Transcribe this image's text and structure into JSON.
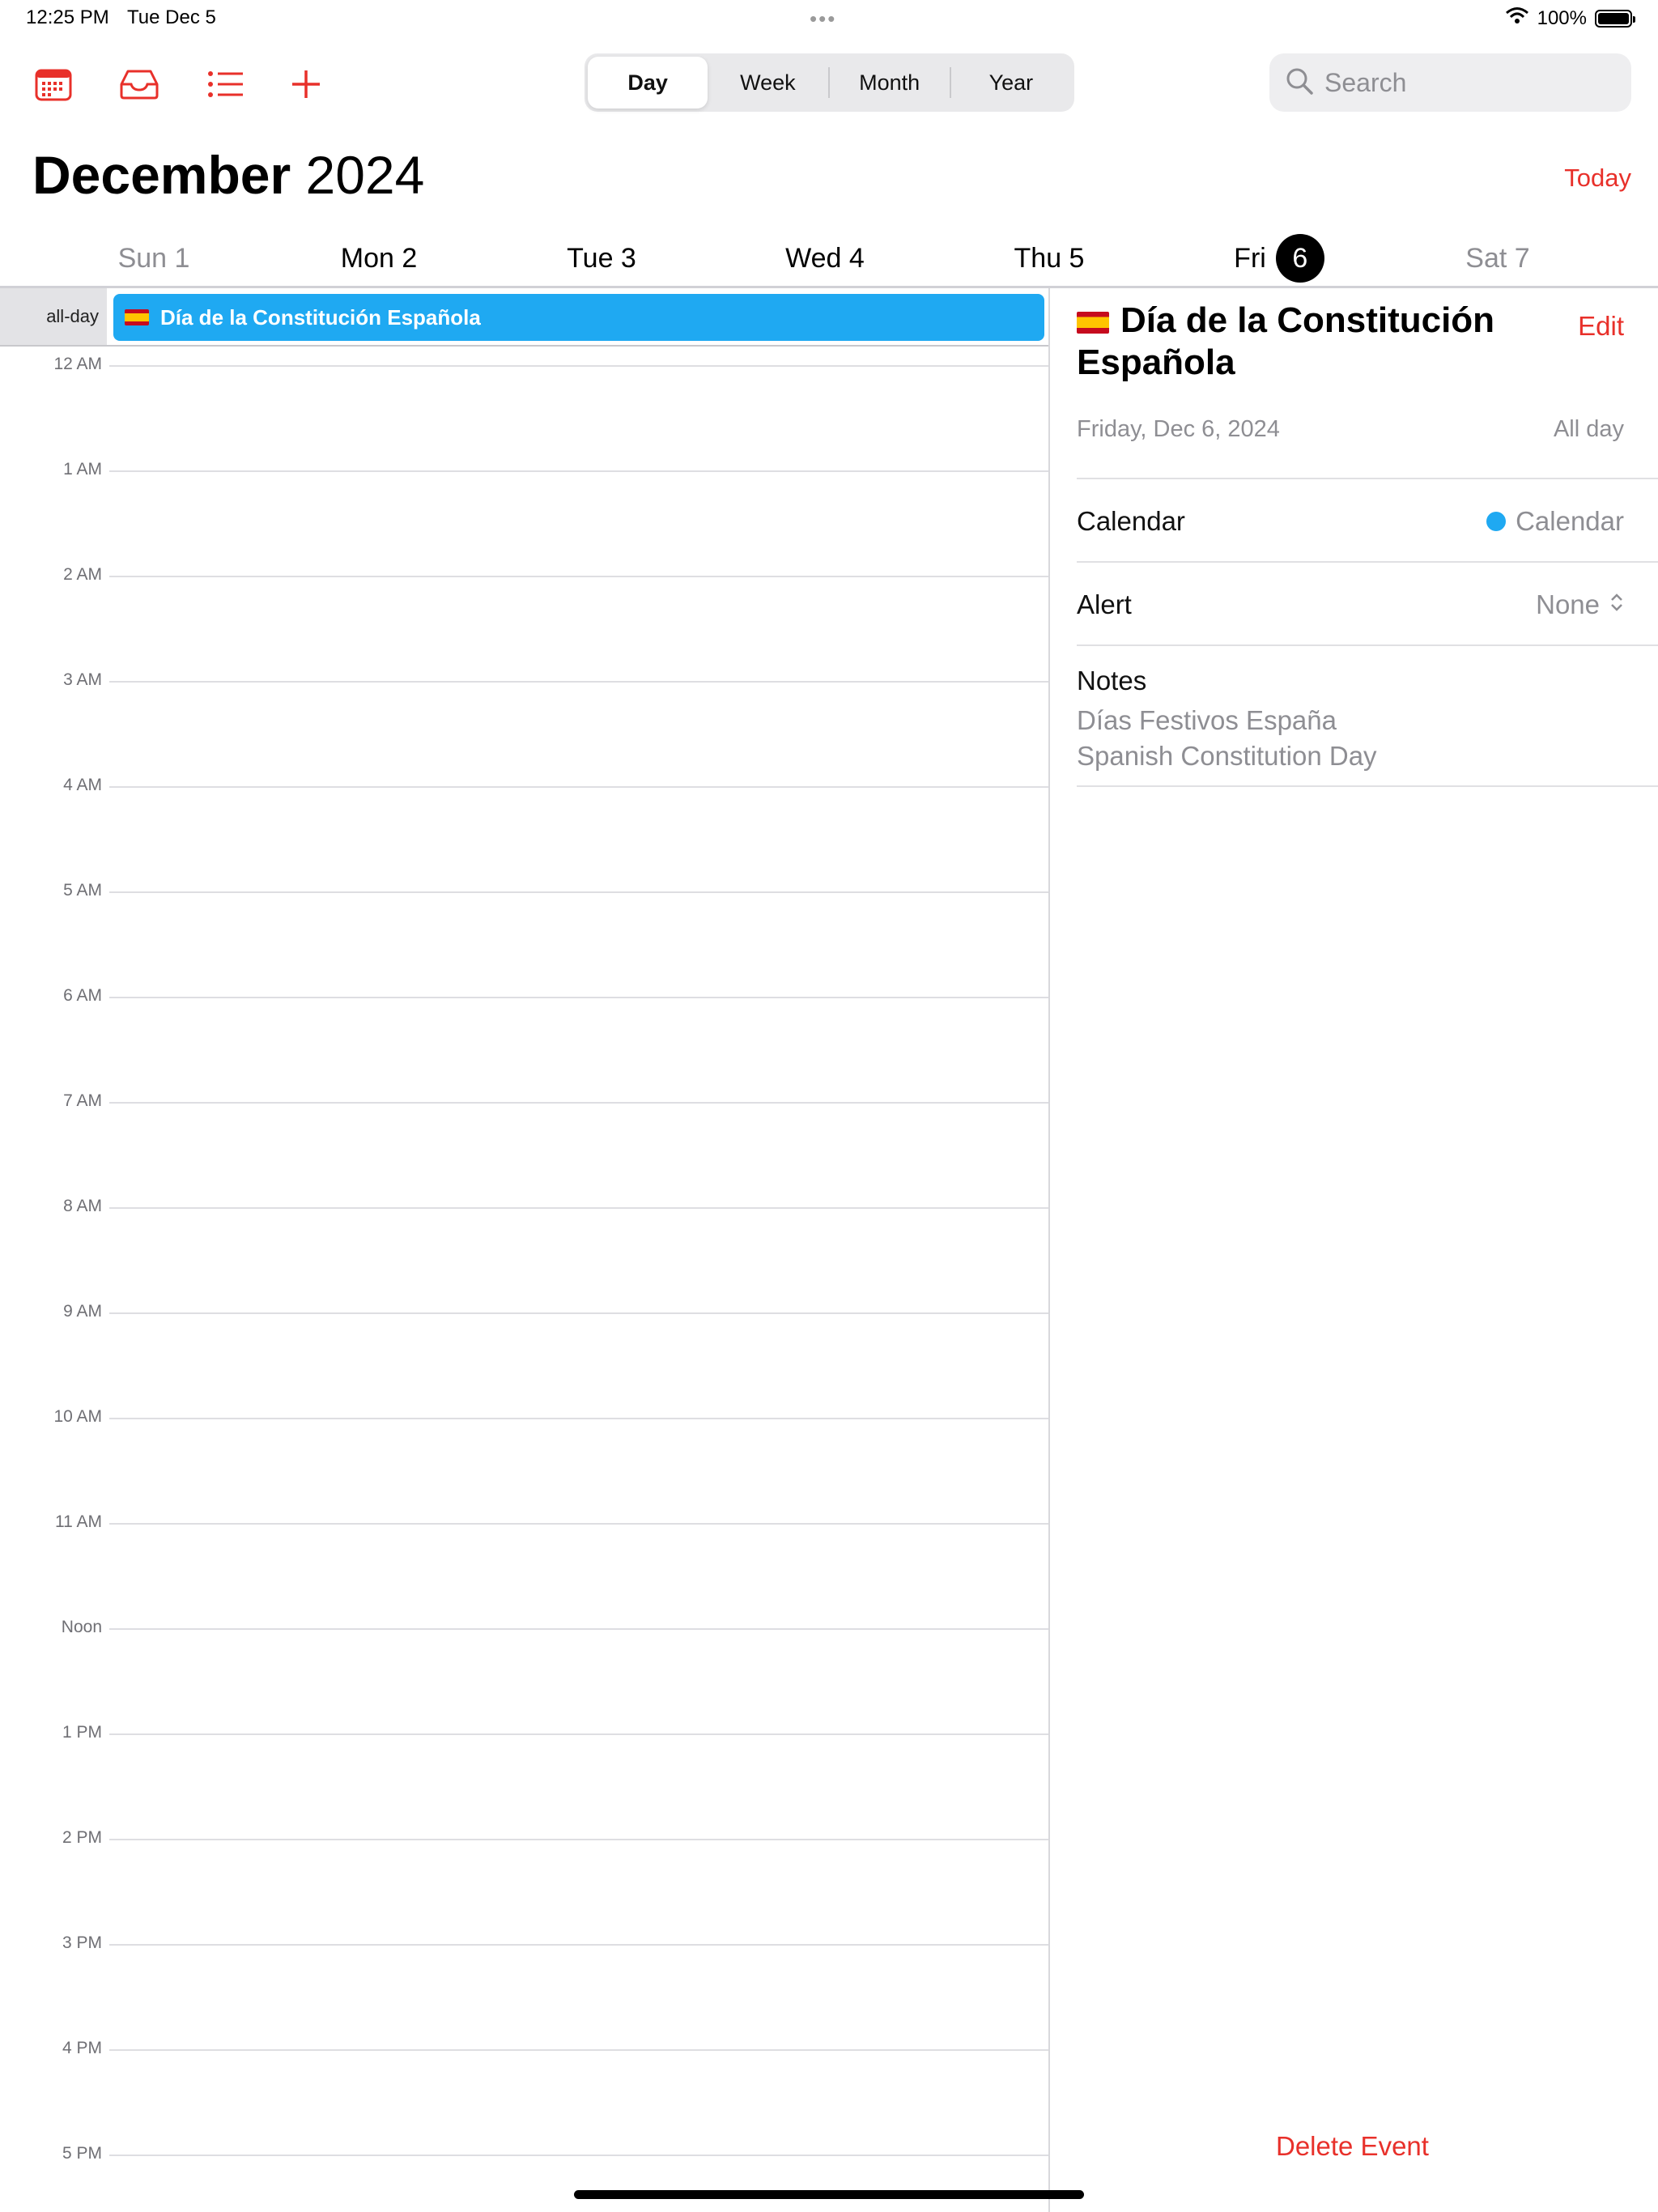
{
  "status": {
    "time": "12:25 PM",
    "date": "Tue Dec 5",
    "dots": "•••",
    "battery": "100%",
    "battery_level": 1.0
  },
  "toolbar": {
    "views": [
      "Day",
      "Week",
      "Month",
      "Year"
    ],
    "selected_view": "Day",
    "search_placeholder": "Search"
  },
  "header": {
    "month": "December",
    "year": "2024",
    "today_label": "Today"
  },
  "week": [
    {
      "label": "Sun 1",
      "dim": true
    },
    {
      "label": "Mon 2",
      "dim": false
    },
    {
      "label": "Tue 3",
      "dim": false
    },
    {
      "label": "Wed 4",
      "dim": false
    },
    {
      "label": "Thu 5",
      "dim": false
    },
    {
      "label": "Fri",
      "num": "6",
      "selected": true
    },
    {
      "label": "Sat 7",
      "dim": true
    }
  ],
  "allday": {
    "label": "all-day",
    "event_title": "Día de la Constitución Española"
  },
  "hours": [
    "12 AM",
    "1 AM",
    "2 AM",
    "3 AM",
    "4 AM",
    "5 AM",
    "6 AM",
    "7 AM",
    "8 AM",
    "9 AM",
    "10 AM",
    "11 AM",
    "Noon",
    "1 PM",
    "2 PM",
    "3 PM",
    "4 PM",
    "5 PM"
  ],
  "detail": {
    "title": "Día de la Constitución Española",
    "edit_label": "Edit",
    "date": "Friday, Dec 6, 2024",
    "all_day": "All day",
    "calendar_label": "Calendar",
    "calendar_value": "Calendar",
    "calendar_color": "#1fa9f2",
    "alert_label": "Alert",
    "alert_value": "None",
    "notes_label": "Notes",
    "notes": [
      "Días Festivos España",
      "Spanish Constitution Day"
    ],
    "delete_label": "Delete Event"
  },
  "colors": {
    "accent": "#e8302a",
    "event": "#1fa9f2"
  }
}
